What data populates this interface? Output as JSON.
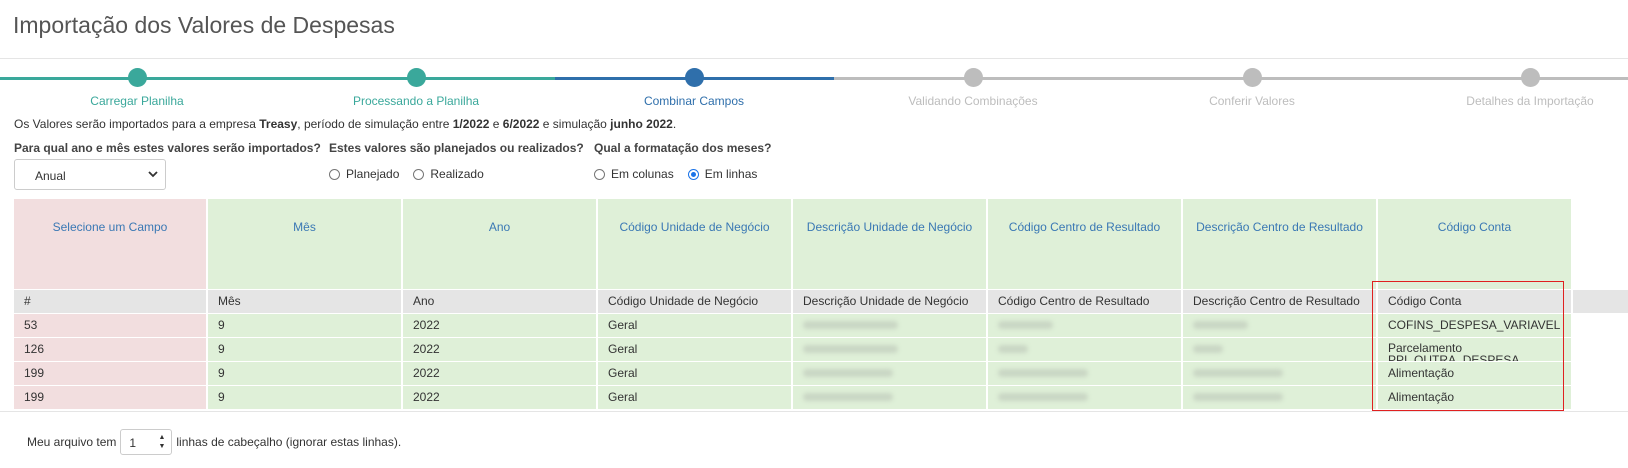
{
  "page": {
    "title": "Importação dos Valores de Despesas"
  },
  "wizard": {
    "steps": [
      {
        "label": "Carregar Planilha",
        "state": "done"
      },
      {
        "label": "Processando a Planilha",
        "state": "done"
      },
      {
        "label": "Combinar Campos",
        "state": "active"
      },
      {
        "label": "Validando Combinações",
        "state": "pending"
      },
      {
        "label": "Conferir Valores",
        "state": "pending"
      },
      {
        "label": "Detalhes da Importação",
        "state": "pending"
      }
    ],
    "colors": {
      "done": "#3aa89b",
      "active": "#2f6fab",
      "pending": "#bdbdbd"
    }
  },
  "info": {
    "prefix": "Os Valores serão importados para a empresa ",
    "company": "Treasy",
    "mid1": ", período de simulação entre ",
    "start": "1/2022",
    "and": " e ",
    "end": "6/2022",
    "mid2": " e simulação ",
    "simulation": "junho 2022",
    "suffix": "."
  },
  "form": {
    "q_period": "Para qual ano e mês estes valores serão importados?",
    "period_value": "Anual",
    "q_type": "Estes valores são planejados ou realizados?",
    "type_options": [
      "Planejado",
      "Realizado"
    ],
    "type_selected": null,
    "q_months": "Qual a formatação dos meses?",
    "months_options": [
      "Em colunas",
      "Em linhas"
    ],
    "months_selected": "Em linhas"
  },
  "table": {
    "field_selects": [
      "Selecione um Campo",
      "Mês",
      "Ano",
      "Código Unidade de Negócio",
      "Descrição Unidade de Negócio",
      "Código Centro de Resultado",
      "Descrição Centro de Resultado",
      "Código Conta"
    ],
    "file_headers": [
      "#",
      "Mês",
      "Ano",
      "Código Unidade de Negócio",
      "Descrição Unidade de Negócio",
      "Código Centro de Resultado",
      "Descrição Centro de Resultado",
      "Código Conta"
    ],
    "rows": [
      [
        "53",
        "9",
        "2022",
        "Geral",
        "",
        "",
        "",
        "COFINS_DESPESA_VARIAVEL"
      ],
      [
        "126",
        "9",
        "2022",
        "Geral",
        "",
        "",
        "",
        "Parcelamento PPI_OUTRA_DESPESA"
      ],
      [
        "199",
        "9",
        "2022",
        "Geral",
        "",
        "",
        "",
        "Alimentação"
      ],
      [
        "199",
        "9",
        "2022",
        "Geral",
        "",
        "",
        "",
        "Alimentação"
      ]
    ]
  },
  "footer": {
    "before": "Meu arquivo tem",
    "header_lines": "1",
    "after": "linhas de cabeçalho (ignorar estas linhas)."
  }
}
